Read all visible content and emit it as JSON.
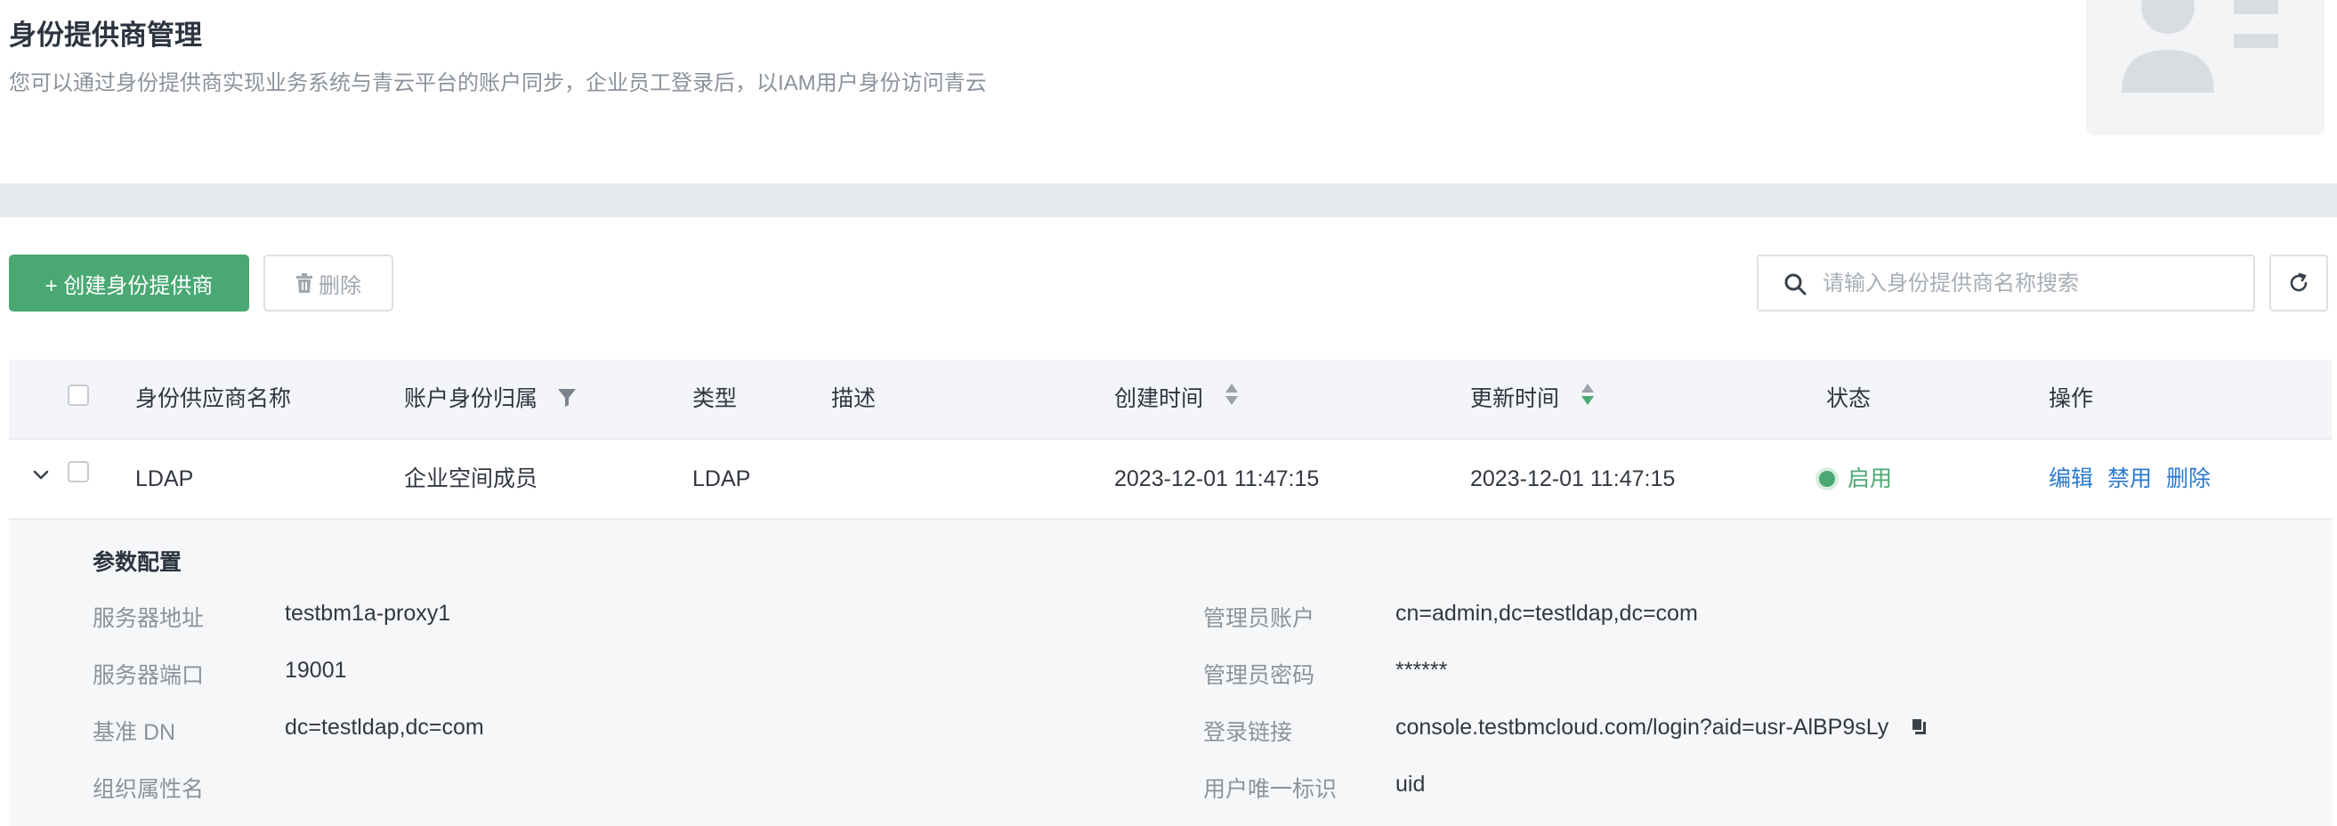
{
  "header": {
    "title": "身份提供商管理",
    "description": "您可以通过身份提供商实现业务系统与青云平台的账户同步，企业员工登录后，以IAM用户身份访问青云"
  },
  "toolbar": {
    "create_label": "+ 创建身份提供商",
    "delete_label": "删除",
    "search_placeholder": "请输入身份提供商名称搜索"
  },
  "table": {
    "columns": {
      "name": "身份供应商名称",
      "belong": "账户身份归属",
      "type": "类型",
      "desc": "描述",
      "created": "创建时间",
      "updated": "更新时间",
      "status": "状态",
      "actions": "操作"
    },
    "rows": [
      {
        "name": "LDAP",
        "belong": "企业空间成员",
        "type": "LDAP",
        "desc": "",
        "created": "2023-12-01 11:47:15",
        "updated": "2023-12-01 11:47:15",
        "status": "启用",
        "actions": [
          "编辑",
          "禁用",
          "删除"
        ]
      }
    ]
  },
  "detail": {
    "title": "参数配置",
    "left": [
      {
        "key": "服务器地址",
        "value": "testbm1a-proxy1"
      },
      {
        "key": "服务器端口",
        "value": "19001"
      },
      {
        "key": "基准 DN",
        "value": "dc=testldap,dc=com"
      },
      {
        "key": "组织属性名",
        "value": ""
      }
    ],
    "right": [
      {
        "key": "管理员账户",
        "value": "cn=admin,dc=testldap,dc=com"
      },
      {
        "key": "管理员密码",
        "value": "******"
      },
      {
        "key": "登录链接",
        "value": "console.testbmcloud.com/login?aid=usr-AlBP9sLy"
      },
      {
        "key": "用户唯一标识",
        "value": "uid"
      }
    ]
  },
  "colors": {
    "primary_green": "#4aa873",
    "link_blue": "#2a7ad0",
    "table_header_bg": "#f3f5f8",
    "detail_bg": "#f6f7f9"
  },
  "icons": [
    "trash-icon",
    "search-icon",
    "refresh-icon",
    "filter-icon",
    "sort-icon",
    "chevron-down-icon",
    "copy-icon"
  ]
}
